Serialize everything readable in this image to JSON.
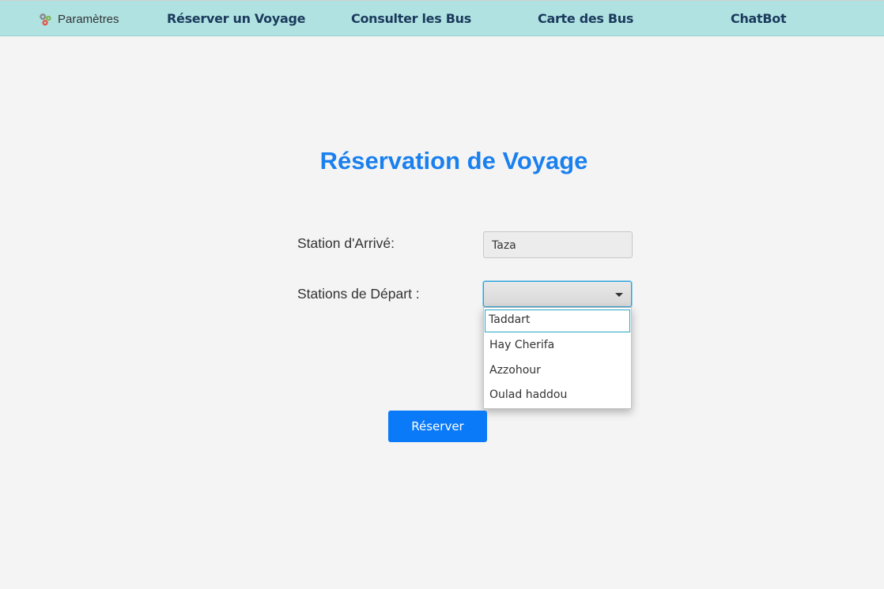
{
  "topbar": {
    "settings_label": "Paramètres",
    "nav": [
      "Réserver un Voyage",
      "Consulter les Bus",
      "Carte des Bus",
      "ChatBot"
    ]
  },
  "form": {
    "title": "Réservation de Voyage",
    "arrival_label": "Station d'Arrivé:",
    "arrival_value": "Taza",
    "departure_label": "Stations de Départ :",
    "departure_value": "",
    "departure_options": [
      "Taddart",
      "Hay Cherifa",
      "Azzohour",
      "Oulad haddou"
    ],
    "submit_label": "Réserver"
  },
  "colors": {
    "topbar": "#b0e2e2",
    "title": "#1a80ee",
    "button": "#0a7af8"
  }
}
